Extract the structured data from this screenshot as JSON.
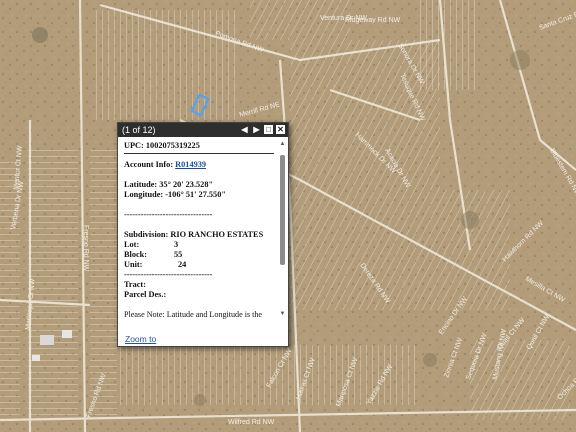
{
  "popup": {
    "counter": "(1 of 12)",
    "buttons": {
      "prev": "◀",
      "next": "▶",
      "maximize": "□",
      "close": "✕"
    },
    "upc_label": "UPC:",
    "upc_value": "1002075319225",
    "account_label": "Account Info:",
    "account_value": "R014939",
    "latitude_label": "Latitude:",
    "latitude_value": "35° 20' 23.528\"",
    "longitude_label": "Longitude:",
    "longitude_value": "-106° 51' 27.550\"",
    "separator": "--------------------------------",
    "subdivision_label": "Subdivision:",
    "subdivision_value": "RIO RANCHO ESTATES",
    "lot_label": "Lot:",
    "lot_value": "3",
    "block_label": "Block:",
    "block_value": "55",
    "unit_label": "Unit:",
    "unit_value": "24",
    "tract_label": "Tract:",
    "parcel_des_label": "Parcel Des.:",
    "note": "Please Note: Latitude and Longitude is the approximate center of the parcel shown.",
    "zoom_link": "Zoom to"
  },
  "map": {
    "street_labels": [
      "Fresno Rd NW",
      "Merrill Rd NE",
      "Pomona Rd NW",
      "Ventura Dr NW",
      "Hammock Dr NW",
      "Acacia Dr NW",
      "Ridgeway Rd NW",
      "Sonora Dr NW",
      "Santa Cruz Rd NW",
      "Tesuque Rd NW",
      "Bluestem Rd NW",
      "Quail Ct NW",
      "Maricopa Ct NW",
      "Verbena Dr NW",
      "Yazzie Rd NW",
      "Sequoia Dr NW",
      "Dereza Rd NW",
      "Mesilla Ct NW",
      "Encino Dr NW",
      "Quail Ct NW",
      "Ochoa Rd NE",
      "Falcon Ct NW",
      "Fresno Rd NW",
      "Mentor Ct NW",
      "Hawaii Ct NW",
      "Wilfred Rd NW",
      "Mustang Rd NW",
      "Mariposa Ct NW",
      "Hawthorn Rd NW",
      "Zinnia Ct NW"
    ],
    "colors": {
      "terrain": "#b09a78",
      "lot_lines": "#f1ece0",
      "selected_parcel": "#4aa3ff"
    }
  }
}
